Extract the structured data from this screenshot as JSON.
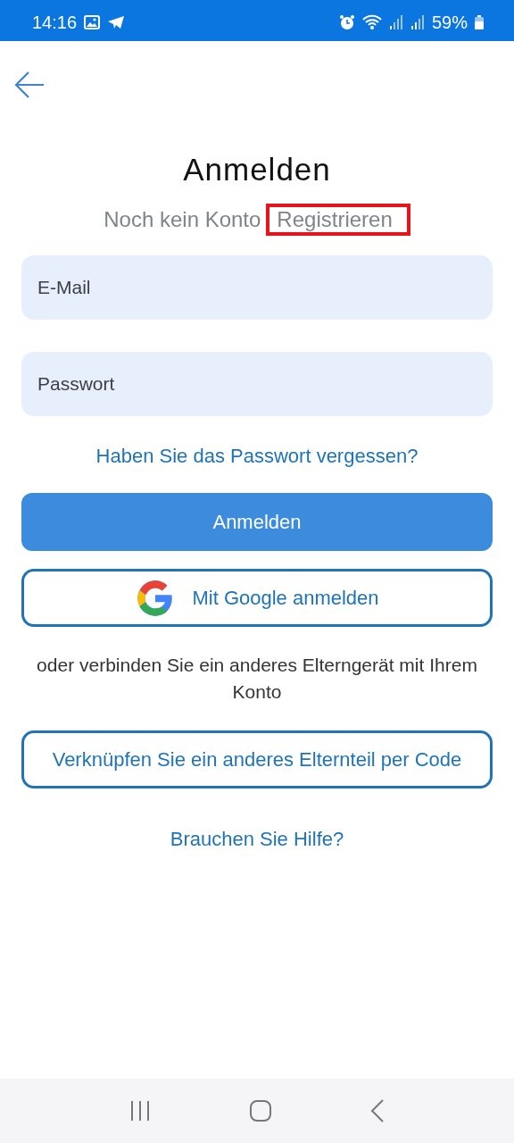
{
  "status_bar": {
    "time": "14:16",
    "battery": "59%"
  },
  "title": "Anmelden",
  "register_prompt": {
    "text": "Noch kein Konto",
    "link": "Registrieren",
    "highlighted": true
  },
  "fields": [
    {
      "placeholder": "E-Mail"
    },
    {
      "placeholder": "Passwort"
    }
  ],
  "forgot_password": "Haben Sie das Passwort vergessen?",
  "login_button": "Anmelden",
  "google_button": "Mit Google anmelden",
  "connect_text": "oder verbinden Sie ein anderes Elterngerät mit Ihrem Konto",
  "link_code_button": "Verknüpfen Sie ein anderes Elternteil per Code",
  "help_link": "Brauchen Sie Hilfe?"
}
